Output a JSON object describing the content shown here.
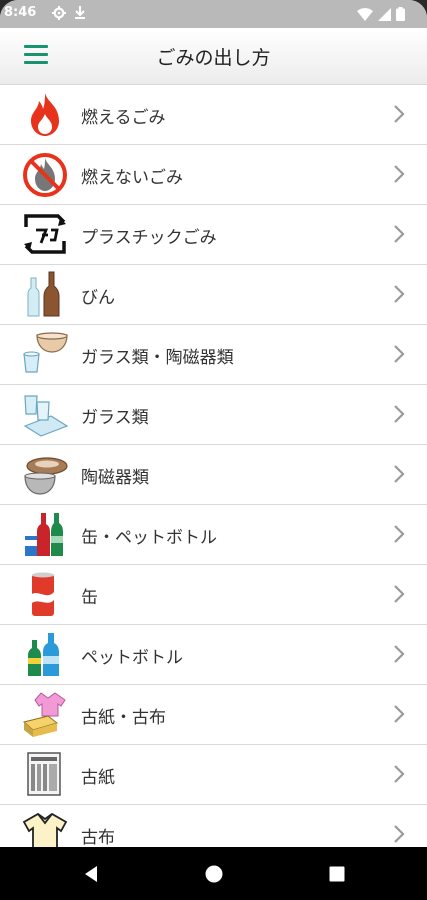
{
  "status_bar": {
    "time": "8:46",
    "icons": [
      "gear-icon",
      "download-icon",
      "wifi-icon",
      "signal-icon",
      "battery-icon"
    ]
  },
  "app_bar": {
    "title": "ごみの出し方",
    "menu_icon": "hamburger-menu-icon",
    "accent_color": "#17936f"
  },
  "categories": [
    {
      "label": "燃えるごみ",
      "icon": "fire-icon"
    },
    {
      "label": "燃えないごみ",
      "icon": "no-fire-icon"
    },
    {
      "label": "プラスチックごみ",
      "icon": "plastic-recycle-icon"
    },
    {
      "label": "びん",
      "icon": "bottles-icon"
    },
    {
      "label": "ガラス類・陶磁器類",
      "icon": "glass-ceramic-icon"
    },
    {
      "label": "ガラス類",
      "icon": "glass-icon"
    },
    {
      "label": "陶磁器類",
      "icon": "ceramic-icon"
    },
    {
      "label": "缶・ペットボトル",
      "icon": "can-pet-bottle-icon"
    },
    {
      "label": "缶",
      "icon": "can-icon"
    },
    {
      "label": "ペットボトル",
      "icon": "pet-bottle-icon"
    },
    {
      "label": "古紙・古布",
      "icon": "paper-cloth-icon"
    },
    {
      "label": "古紙",
      "icon": "paper-icon"
    },
    {
      "label": "古布",
      "icon": "cloth-icon"
    }
  ],
  "nav_bar": {
    "buttons": [
      "back-icon",
      "home-icon",
      "recents-icon"
    ]
  }
}
